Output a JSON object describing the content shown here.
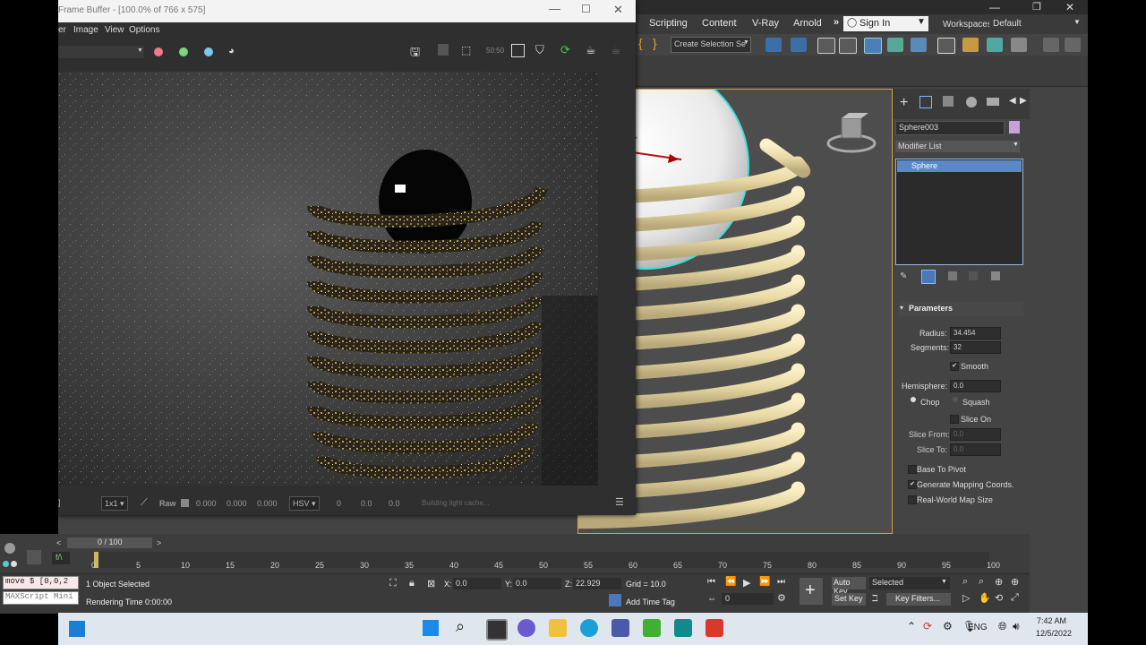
{
  "max": {
    "menu": [
      "Scripting",
      "Content",
      "V-Ray",
      "Arnold"
    ],
    "menu_more": "»",
    "signin_label": "Sign In",
    "workspaces_label": "Workspaces:",
    "workspace_value": "Default",
    "selection_set_placeholder": "Create Selection Se",
    "window_controls": [
      "—",
      "❐",
      "✕"
    ]
  },
  "command_panel": {
    "object_name": "Sphere003",
    "object_color": "#c9a0dc",
    "modifier_list_label": "Modifier List",
    "stack_item": "Sphere",
    "rollout_title": "Parameters",
    "radius_label": "Radius:",
    "radius_value": "34.454",
    "segments_label": "Segments:",
    "segments_value": "32",
    "smooth_label": "Smooth",
    "hemisphere_label": "Hemisphere:",
    "hemisphere_value": "0.0",
    "chop_label": "Chop",
    "squash_label": "Squash",
    "slice_on_label": "Slice On",
    "slice_from_label": "Slice From:",
    "slice_from_value": "0.0",
    "slice_to_label": "Slice To:",
    "slice_to_value": "0.0",
    "base_to_pivot_label": "Base To Pivot",
    "gen_mapping_label": "Generate Mapping Coords.",
    "real_world_label": "Real-World Map Size"
  },
  "frame_buffer": {
    "title": "Frame Buffer - [100.0% of 766 x 575]",
    "menu": [
      "er",
      "Image",
      "View",
      "Options"
    ],
    "channel_colors": [
      "#f07a8a",
      "#7ad87a",
      "#7ac8f0"
    ],
    "status": {
      "bracket": "]",
      "sampling": "1x1",
      "raw_label": "Raw",
      "rgb_values": [
        "0.000",
        "0.000",
        "0.000"
      ],
      "color_mode": "HSV",
      "hsv_values": [
        "0",
        "0.0",
        "0.0"
      ],
      "message": "Building light cache..."
    }
  },
  "timeline": {
    "frame_counter": "0 / 100",
    "ticks": [
      "0",
      "5",
      "10",
      "15",
      "20",
      "25",
      "30",
      "35",
      "40",
      "45",
      "50",
      "55",
      "60",
      "65",
      "70",
      "75",
      "80",
      "85",
      "90",
      "95",
      "100"
    ]
  },
  "status": {
    "script_line1": "move $ [0,0,2",
    "script_line2": "MAXScript Mini",
    "selected": "1 Object Selected",
    "rendering_time": "Rendering Time  0:00:00",
    "x_label": "X:",
    "x_value": "0.0",
    "y_label": "Y:",
    "y_value": "0.0",
    "z_label": "Z:",
    "z_value": "22.929",
    "grid": "Grid = 10.0",
    "add_time_tag": "Add Time Tag",
    "frame_value": "0",
    "auto_key": "Auto Key",
    "set_key": "Set Key",
    "selected_dropdown": "Selected",
    "key_filters": "Key Filters..."
  },
  "taskbar": {
    "lang": "ENG",
    "time": "7:42 AM",
    "date": "12/5/2022"
  }
}
